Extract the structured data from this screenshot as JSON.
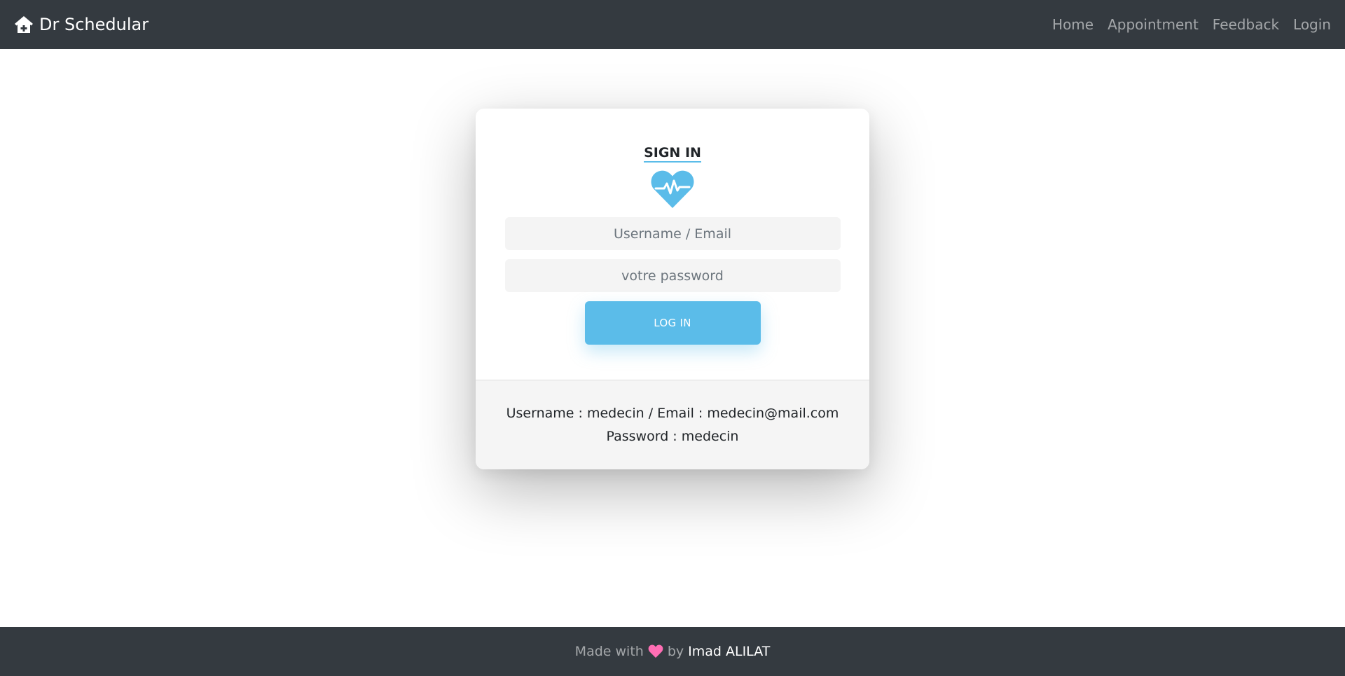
{
  "navbar": {
    "brand": "Dr Schedular",
    "brand_icon": "home-medical-icon",
    "links": [
      "Home",
      "Appointment",
      "Feedback",
      "Login"
    ]
  },
  "login_card": {
    "title": "SIGN IN",
    "logo_icon": "heartbeat-icon",
    "username_placeholder": "Username / Email",
    "password_placeholder": "votre password",
    "button_label": "LOG IN",
    "hint_line1": "Username : medecin / Email : medecin@mail.com",
    "hint_line2": "Password : medecin"
  },
  "footer": {
    "made_with": "Made with",
    "heart_icon": "heart-icon",
    "by": "by",
    "author": "Imad ALILAT"
  },
  "colors": {
    "navbar_bg": "#343a40",
    "accent": "#5bbce9",
    "heart": "#ff6eb4"
  }
}
